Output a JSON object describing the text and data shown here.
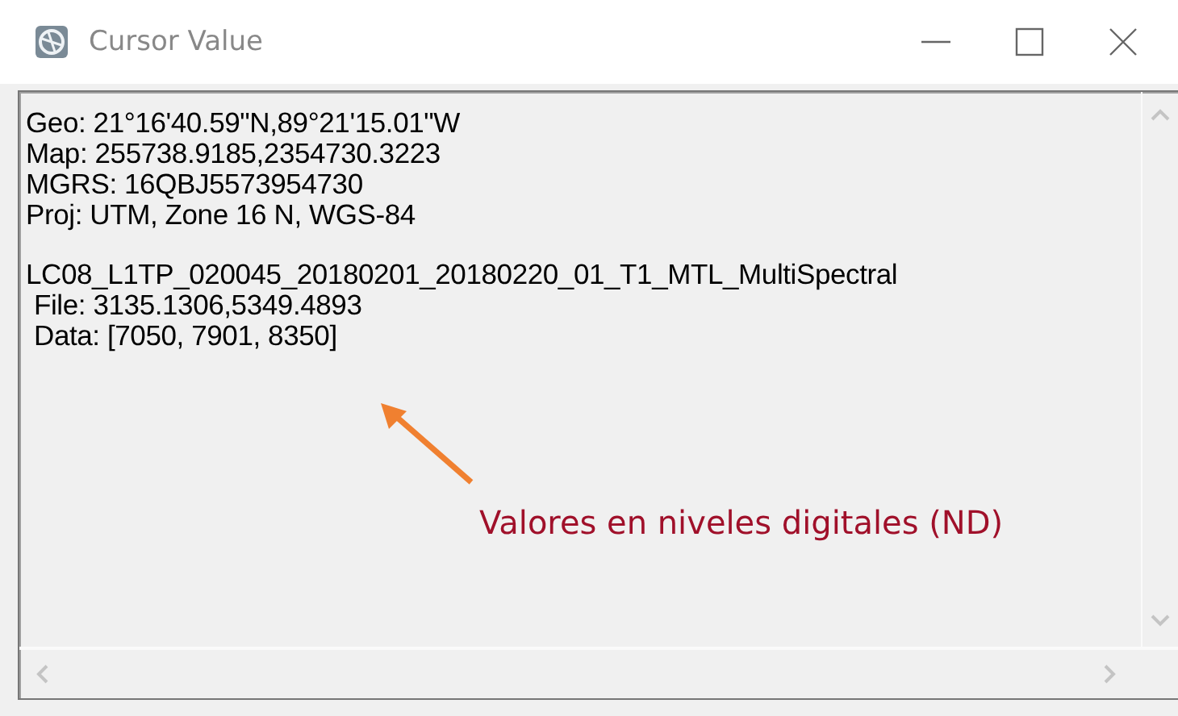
{
  "window": {
    "title": "Cursor Value"
  },
  "blocks": [
    {
      "lines": [
        {
          "text": "Geo: 21°16'40.59\"N,89°21'15.01\"W",
          "indent": false
        },
        {
          "text": "Map: 255738.9185,2354730.3223",
          "indent": false
        },
        {
          "text": "MGRS: 16QBJ5573954730",
          "indent": false
        },
        {
          "text": "Proj: UTM, Zone 16 N, WGS-84",
          "indent": false
        }
      ]
    },
    {
      "lines": [
        {
          "text": "LC08_L1TP_020045_20180201_20180220_01_T1_MTL_MultiSpectral",
          "indent": false
        },
        {
          "text": "File: 3135.1306,5349.4893",
          "indent": true
        },
        {
          "text": "Data: [7050, 7901, 8350]",
          "indent": true
        }
      ]
    }
  ],
  "annotation": {
    "text": "Valores en niveles digitales (ND)"
  }
}
